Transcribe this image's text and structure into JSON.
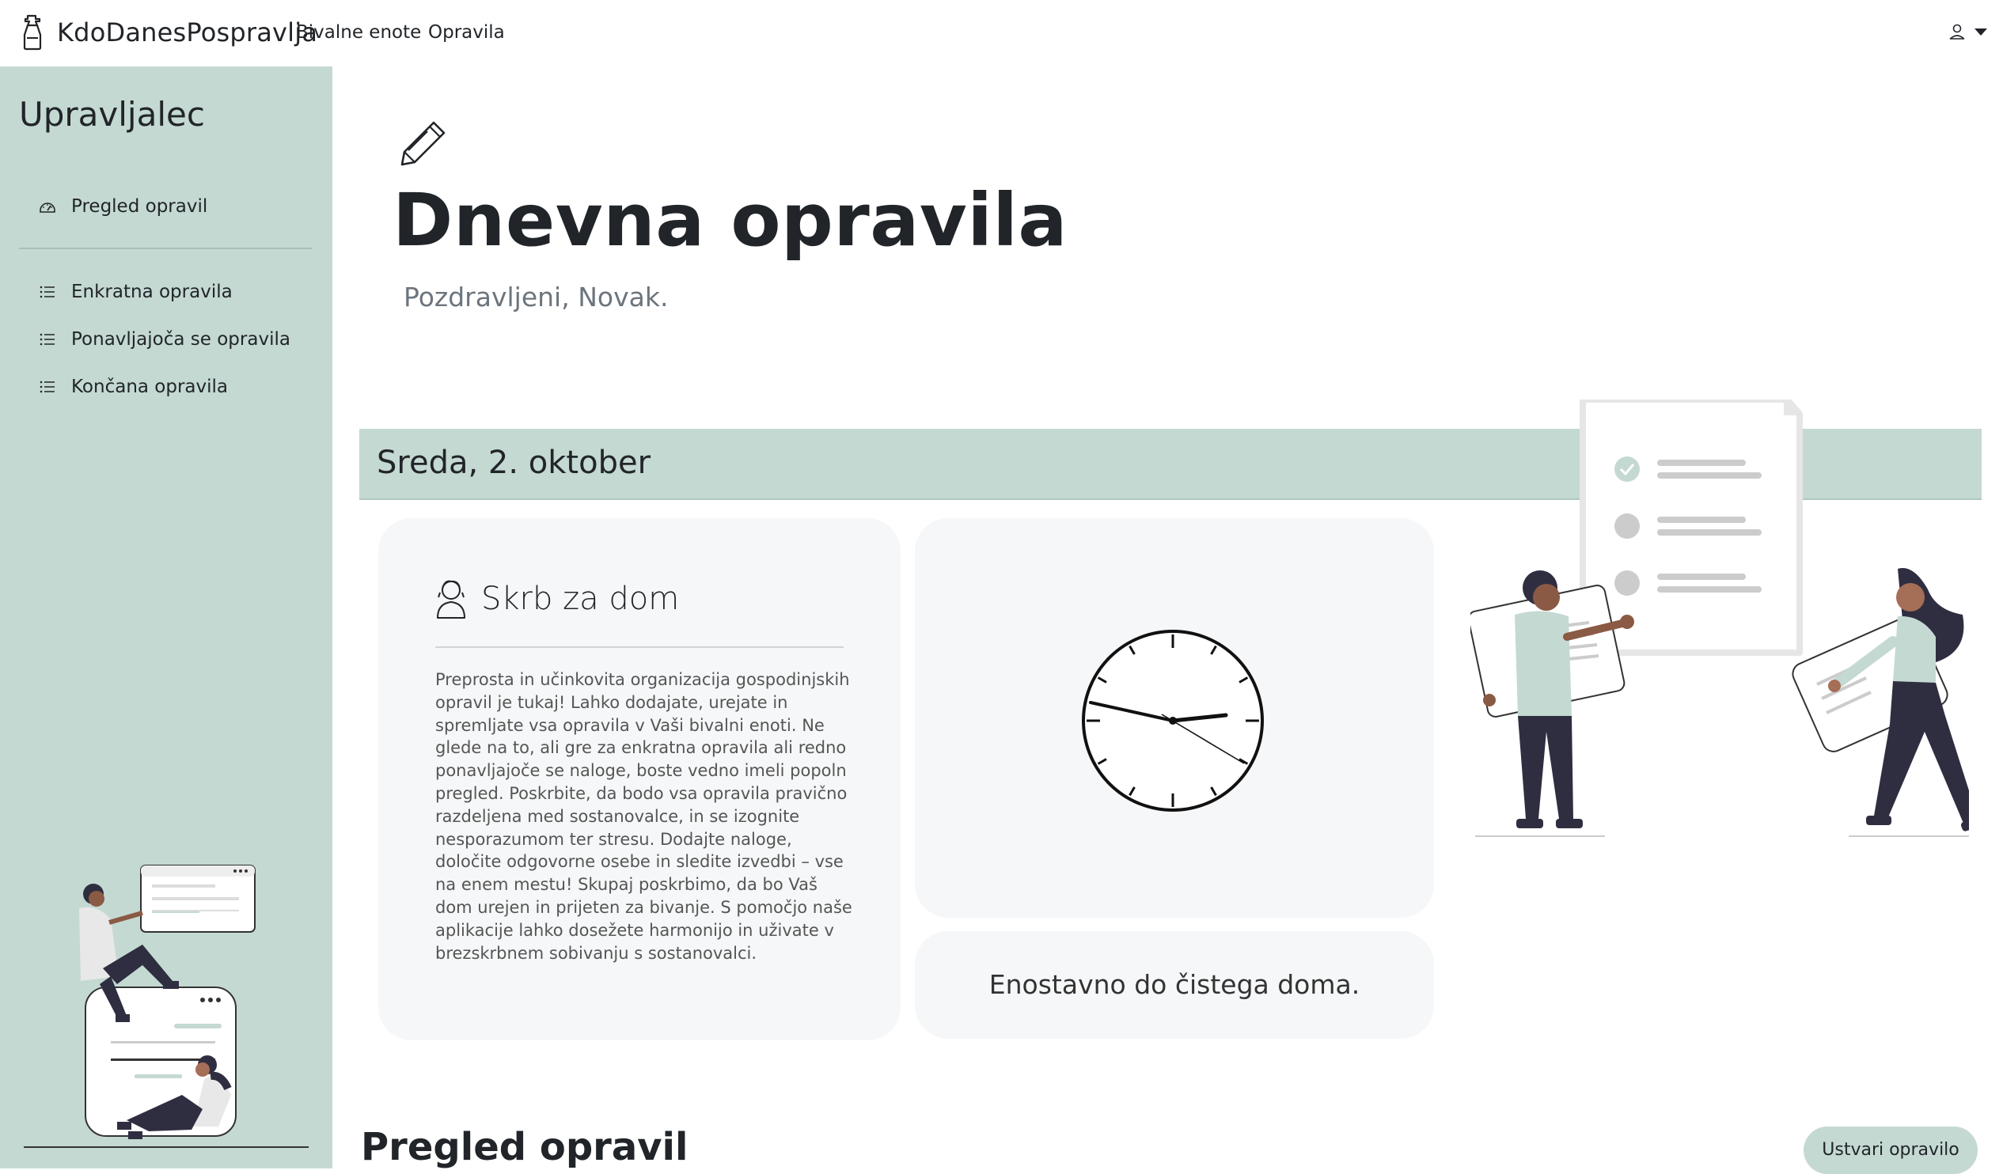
{
  "navbar": {
    "brand": "KdoDanesPospravlja",
    "links": [
      "Bivalne enote",
      "Opravila"
    ]
  },
  "sidebar": {
    "title": "Upravljalec",
    "items": [
      {
        "label": "Pregled opravil",
        "icon": "dashboard-icon"
      },
      {
        "label": "Enkratna opravila",
        "icon": "list-icon"
      },
      {
        "label": "Ponavljajoča se opravila",
        "icon": "list-icon"
      },
      {
        "label": "Končana opravila",
        "icon": "list-icon"
      }
    ]
  },
  "main": {
    "title": "Dnevna opravila",
    "greeting": "Pozdravljeni, Novak.",
    "date": "Sreda, 2. oktober",
    "info_card": {
      "heading": "Skrb za dom",
      "description": "Preprosta in učinkovita organizacija gospodinjskih opravil je tukaj! Lahko dodajate, urejate in spremljate vsa opravila v Vaši bivalni enoti. Ne glede na to, ali gre za enkratna opravila ali redno ponavljajoče se naloge, boste vedno imeli popoln pregled. Poskrbite, da bodo vsa opravila pravično razdeljena med sostanovalce, in se izognite nesporazumom ter stresu. Dodajte naloge, določite odgovorne osebe in sledite izvedbi – vse na enem mestu! Skupaj poskrbimo, da bo Vaš dom urejen in prijeten za bivanje. S pomočjo naše aplikacije lahko dosežete harmonijo in uživate v brezskrbnem sobivanju s sostanovalci."
    },
    "slogan": "Enostavno do čistega doma.",
    "section_title": "Pregled opravil",
    "create_button": "Ustvari opravilo"
  },
  "colors": {
    "accent": "#c4d9d2",
    "card_bg": "#f6f7f8",
    "text": "#212529",
    "muted": "#6c757d"
  }
}
